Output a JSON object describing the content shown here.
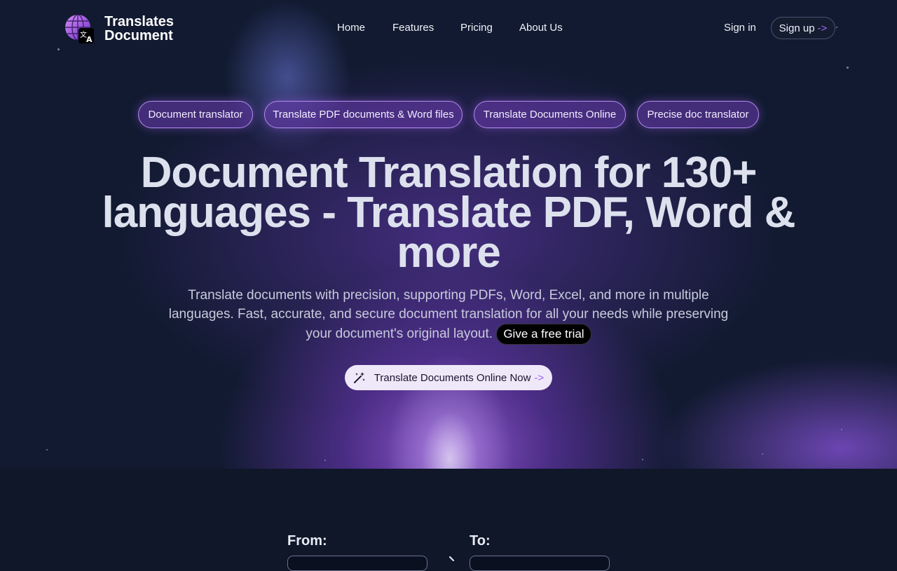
{
  "brand": {
    "line1": "Translates",
    "line2": "Document",
    "icon": "globe-translate-icon"
  },
  "nav": {
    "home": "Home",
    "features": "Features",
    "pricing": "Pricing",
    "about": "About Us"
  },
  "auth": {
    "signin": "Sign in",
    "signup": "Sign up",
    "signup_arrow": "->"
  },
  "pills": [
    "Document translator",
    "Translate PDF documents & Word files",
    "Translate Documents Online",
    "Precise doc translator"
  ],
  "hero": {
    "title": "Document Translation for 130+ languages - Translate PDF, Word & more",
    "subtitle": "Translate documents with precision, supporting PDFs, Word, Excel, and more in multiple languages. Fast, accurate, and secure document translation for all your needs while preserving your document's original layout.",
    "trial": "Give a free trial",
    "cta": "Translate Documents Online Now",
    "cta_arrow": "->",
    "cta_icon": "magic-wand-icon"
  },
  "translator": {
    "from_label": "From:",
    "to_label": "To:",
    "swap_icon": "arrow-right-icon"
  },
  "colors": {
    "accent": "#a66cf0",
    "background": "#0f1729",
    "pill_border": "#b48ef0"
  }
}
